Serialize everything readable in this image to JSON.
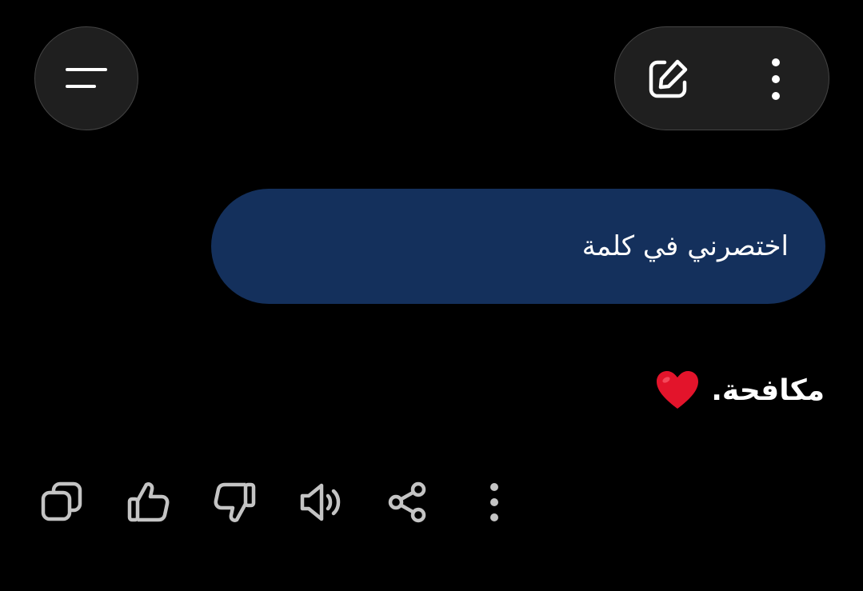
{
  "header": {
    "menu_icon": "menu-lines-icon",
    "new_chat_icon": "edit-icon",
    "more_icon": "vertical-dots-icon"
  },
  "conversation": {
    "user_message": "اختصرني في كلمة",
    "reply_text": "مكافحة.",
    "reply_emoji": "red-heart",
    "colors": {
      "user_bubble": "#14305c",
      "background": "#000000",
      "heart": "#e3142b",
      "icon": "#c4c4c4"
    }
  },
  "actions": [
    {
      "name": "copy",
      "icon": "copy-icon"
    },
    {
      "name": "like",
      "icon": "thumbs-up-icon"
    },
    {
      "name": "dislike",
      "icon": "thumbs-down-icon"
    },
    {
      "name": "read-aloud",
      "icon": "speaker-icon"
    },
    {
      "name": "share",
      "icon": "share-icon"
    },
    {
      "name": "more",
      "icon": "vertical-dots-icon"
    }
  ]
}
